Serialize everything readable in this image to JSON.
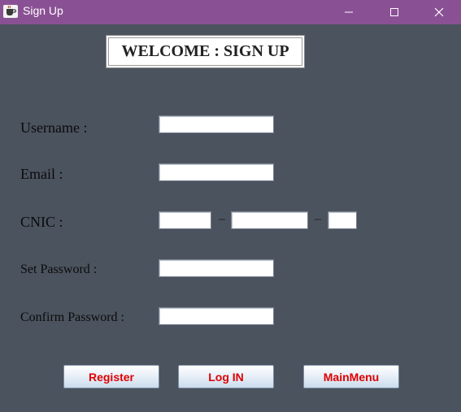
{
  "window": {
    "title": "Sign Up"
  },
  "form": {
    "heading": "WELCOME : SIGN UP",
    "username": {
      "label": "Username :",
      "value": ""
    },
    "email": {
      "label": "Email :",
      "value": ""
    },
    "cnic": {
      "label": "CNIC :",
      "part1": "",
      "part2": "",
      "part3": "",
      "separator": "–"
    },
    "set_password": {
      "label": "Set Password :",
      "value": ""
    },
    "confirm_password": {
      "label": "Confirm Password :",
      "value": ""
    }
  },
  "buttons": {
    "register": "Register",
    "login": "Log IN",
    "mainmenu": "MainMenu"
  },
  "colors": {
    "titlebar": "#8a5094",
    "background": "#4b535e",
    "button_text": "#e00000"
  },
  "icons": {
    "app": "java-coffee-icon",
    "minimize": "minimize-icon",
    "maximize": "maximize-icon",
    "close": "close-icon"
  }
}
